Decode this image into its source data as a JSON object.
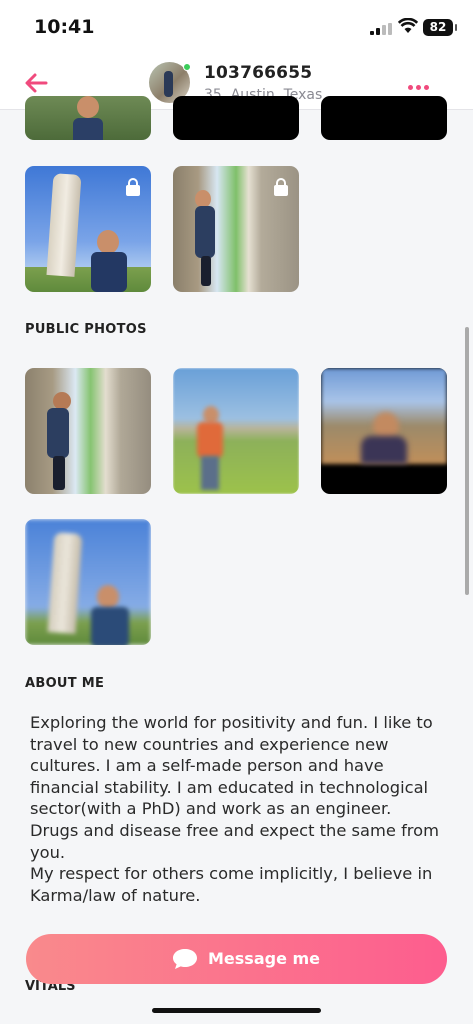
{
  "status_bar": {
    "time": "10:41",
    "battery": "82"
  },
  "header": {
    "username": "103766655",
    "location": "35, Austin, Texas"
  },
  "sections": {
    "public_photos": "PUBLIC PHOTOS",
    "about_me": "ABOUT ME",
    "vitals": "VITALS"
  },
  "about": {
    "paragraphs": [
      "Exploring the world for positivity and fun. I like to travel to new countries and experience new cultures. I am a self-made person and have financial stability. I am educated in technological sector(with a PhD) and work as an engineer.",
      "Drugs and disease free and expect the same from you.",
      "My respect for others come implicitly, I believe in Karma/law of nature."
    ]
  },
  "actions": {
    "message_label": "Message me"
  },
  "colors": {
    "accent": "#f04a7d",
    "button_start": "#f98a8c",
    "button_end": "#fd5d8e",
    "online": "#3ccc5a"
  }
}
